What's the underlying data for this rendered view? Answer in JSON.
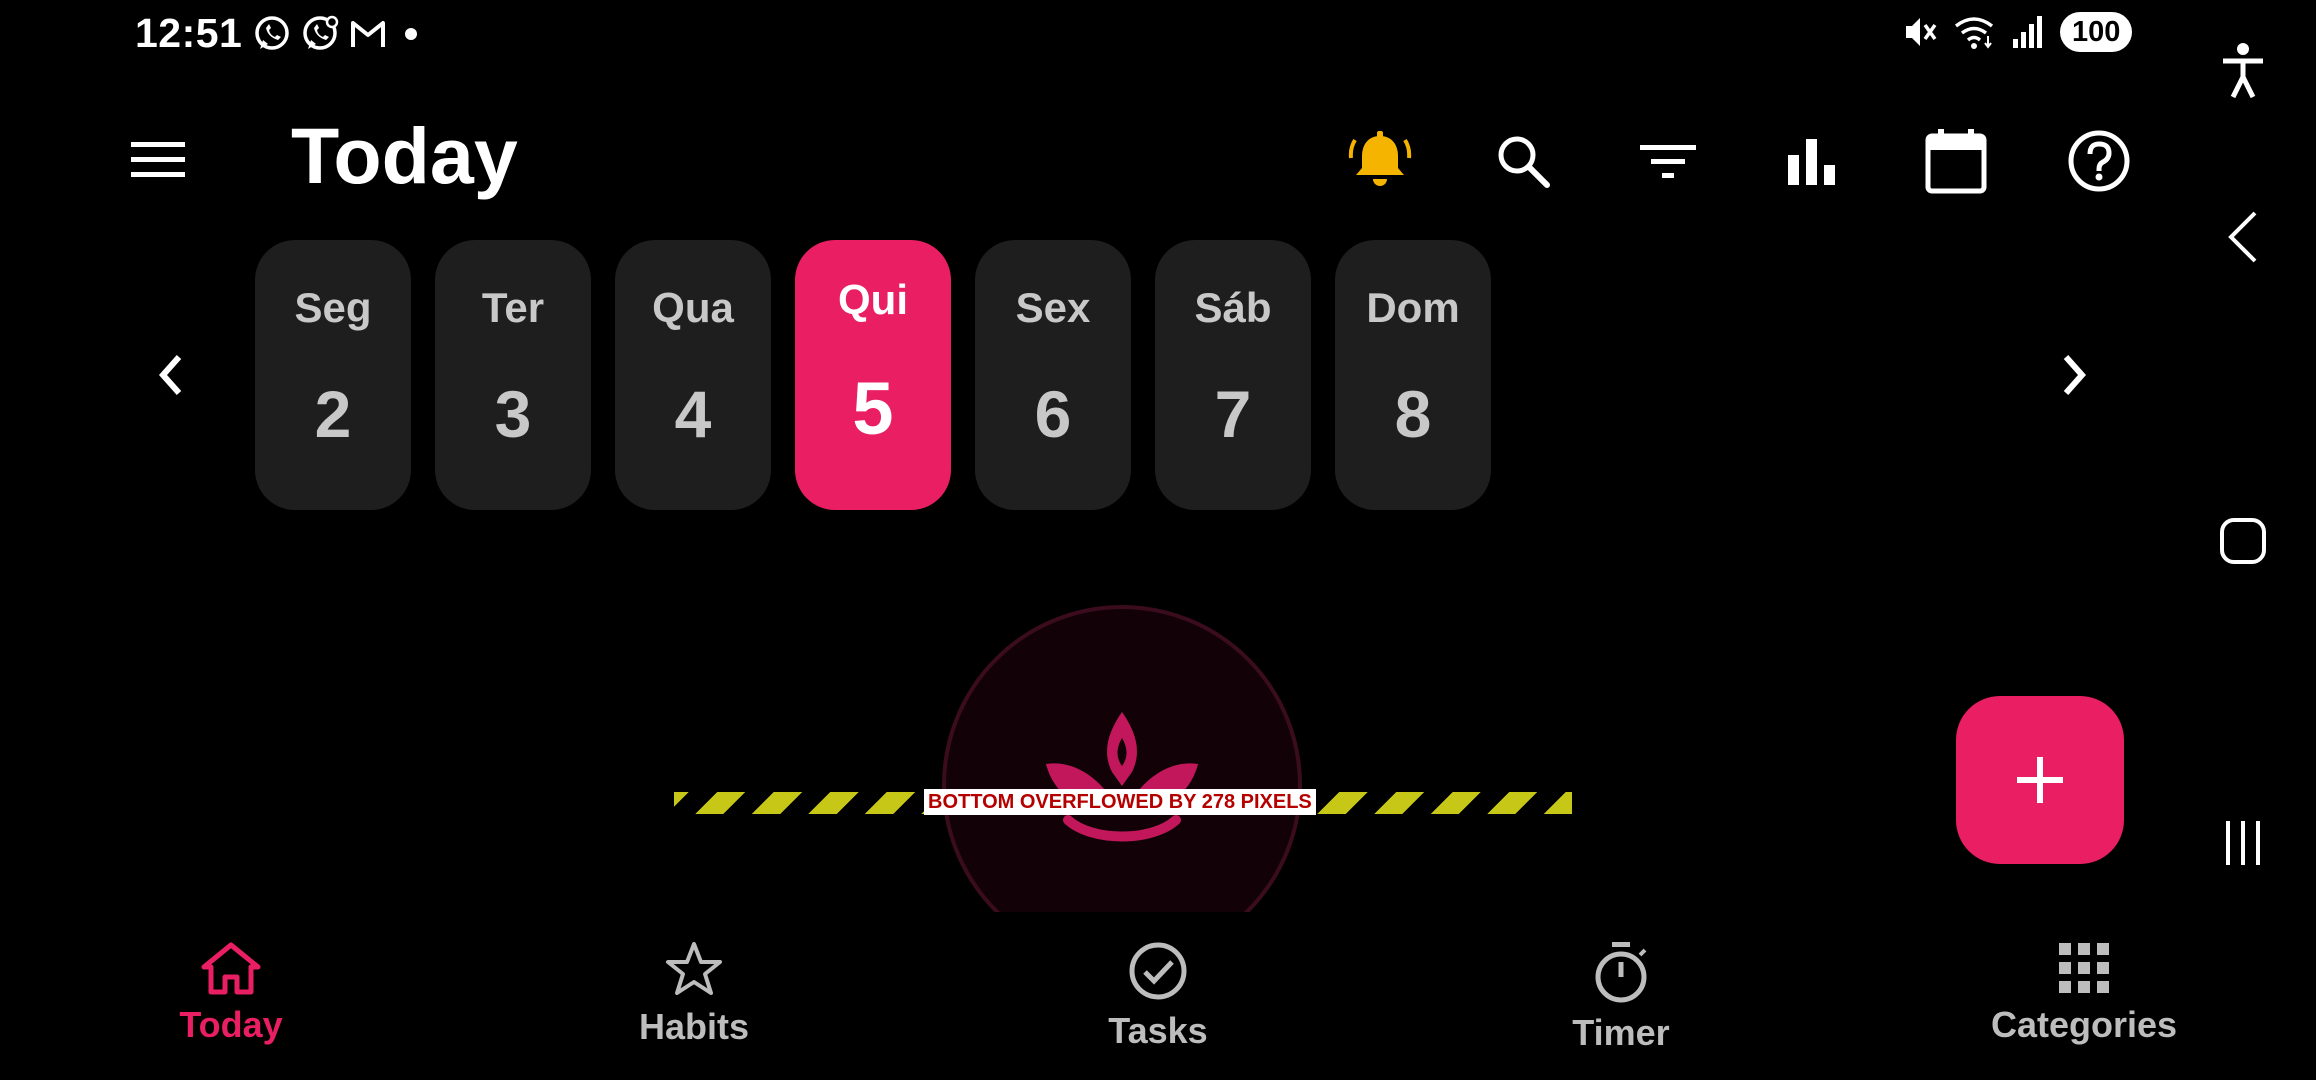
{
  "status_bar": {
    "time": "12:51",
    "left_icons": [
      "whatsapp-icon",
      "whatsapp-business-icon",
      "gmail-icon",
      "dot-icon"
    ],
    "right_icons": [
      "mute-icon",
      "wifi-icon",
      "signal-icon"
    ],
    "battery": "100"
  },
  "app_bar": {
    "title": "Today",
    "actions": [
      "bell-icon",
      "search-icon",
      "filter-icon",
      "bar-chart-icon",
      "calendar-icon",
      "help-icon"
    ],
    "bell_color": "#f5b400"
  },
  "day_selector": {
    "days": [
      {
        "name": "Seg",
        "num": "2"
      },
      {
        "name": "Ter",
        "num": "3"
      },
      {
        "name": "Qua",
        "num": "4"
      },
      {
        "name": "Qui",
        "num": "5"
      },
      {
        "name": "Sex",
        "num": "6"
      },
      {
        "name": "Sáb",
        "num": "7"
      },
      {
        "name": "Dom",
        "num": "8"
      }
    ],
    "selected_index": 3
  },
  "overflow_banner": {
    "text": "BOTTOM OVERFLOWED BY 278 PIXELS"
  },
  "fab": {
    "icon": "plus-icon"
  },
  "bottom_nav": {
    "items": [
      {
        "label": "Today",
        "icon": "home-icon"
      },
      {
        "label": "Habits",
        "icon": "star-icon"
      },
      {
        "label": "Tasks",
        "icon": "check-circle-icon"
      },
      {
        "label": "Timer",
        "icon": "timer-icon"
      },
      {
        "label": "Categories",
        "icon": "grid-icon"
      }
    ],
    "active_index": 0
  },
  "system_nav": [
    "accessibility-icon",
    "back-icon",
    "home-button-icon",
    "recents-icon"
  ],
  "colors": {
    "accent": "#e91e63",
    "card": "#1e1e1e",
    "background": "#000000"
  }
}
